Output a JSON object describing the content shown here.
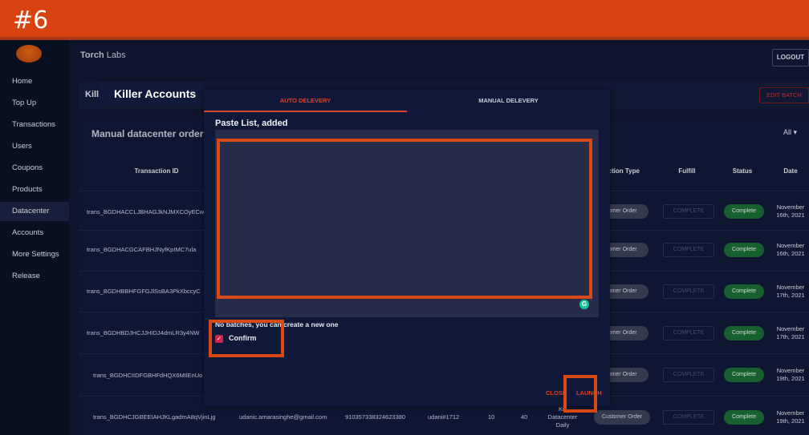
{
  "banner": {
    "step": "#6"
  },
  "app": {
    "brand_bold": "Torch",
    "brand_rest": " Labs",
    "logout": "LOGOUT"
  },
  "sidebar": {
    "items": [
      {
        "label": "Home"
      },
      {
        "label": "Top Up"
      },
      {
        "label": "Transactions"
      },
      {
        "label": "Users"
      },
      {
        "label": "Coupons"
      },
      {
        "label": "Products"
      },
      {
        "label": "Datacenter"
      },
      {
        "label": "Accounts"
      },
      {
        "label": "More Settings"
      },
      {
        "label": "Release"
      }
    ],
    "active": "Datacenter"
  },
  "batch_card": {
    "title_fragment": "Kill",
    "edit_batch": "EDIT BATCH"
  },
  "orders": {
    "title": "Manual datacenter orders t",
    "filter": "All",
    "columns": [
      "Transaction ID",
      "action Type",
      "Fulfill",
      "Status",
      "Date"
    ],
    "rows": [
      {
        "id": "trans_BGDHACCLJBHAGJkNJMXCOyECw",
        "type": "stomer Order",
        "fulfill": "COMPLETE",
        "status": "Complete",
        "date1": "November",
        "date2": "16th, 2021"
      },
      {
        "id": "trans_BGDHACGCAFBHJNyfKpIMC7ula",
        "type": "stomer Order",
        "fulfill": "COMPLETE",
        "status": "Complete",
        "date1": "November",
        "date2": "16th, 2021"
      },
      {
        "id": "trans_BGDHBBHFGFGJlSsBA3PkXbccyC",
        "type": "stomer Order",
        "fulfill": "COMPLETE",
        "status": "Complete",
        "date1": "November",
        "date2": "17th, 2021"
      },
      {
        "id": "trans_BGDHBDJHCJJHIDJ4dmLR3y4NW",
        "type": "stomer Order",
        "fulfill": "COMPLETE",
        "status": "Complete",
        "date1": "November",
        "date2": "17th, 2021"
      },
      {
        "id": "trans_BGDHCIIDFGBHFdHQX6MIlEnUo",
        "type": "stomer Order",
        "fulfill": "COMPLETE",
        "status": "Complete",
        "date1": "November",
        "date2": "19th, 2021"
      }
    ],
    "last_row": {
      "id": "trans_BGDHCJGBEEIAHJKLgadmA8qVjinLjg",
      "email": "udanic.amarasinghe@gmail.com",
      "phone": "910357338324623380",
      "user": "udani#1712",
      "qty": "10",
      "amount": "40",
      "product_1": "Kill",
      "product_2": "Datacenter",
      "product_3": "Daily",
      "type": "Customer Order",
      "fulfill": "COMPLETE",
      "status": "Complete",
      "date1": "November",
      "date2": "19th, 2021"
    }
  },
  "modal": {
    "heading": "Killer Accounts",
    "tabs": [
      {
        "label": "AUTO DELEVERY"
      },
      {
        "label": "MANUAL DELEVERY"
      }
    ],
    "paste_label": "Paste List, added",
    "paste_value": "",
    "no_batches": "No batches, you can create a new one",
    "confirm_label": "Confirm",
    "confirm_checked": true,
    "close": "CLOSE",
    "launch": "LAUNCH"
  },
  "colors": {
    "accent": "#d9422c",
    "highlight": "#d84a14",
    "banner": "#d94312",
    "status_green": "#1c6f35"
  }
}
